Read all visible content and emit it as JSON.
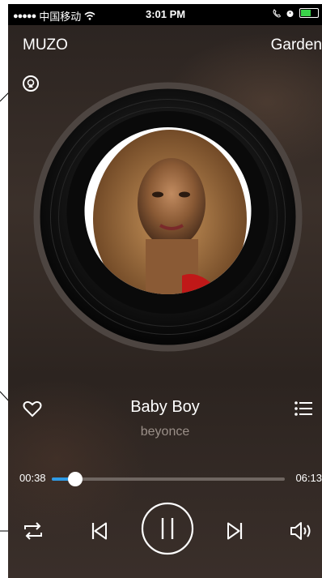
{
  "status_bar": {
    "signal": "●●●●●",
    "carrier": "中国移动",
    "time": "3:01 PM"
  },
  "header": {
    "app_name": "MUZO",
    "room": "Garden"
  },
  "now_playing": {
    "title": "Baby Boy",
    "artist": "beyonce",
    "elapsed": "00:38",
    "total": "06:13",
    "progress_fraction": 0.102
  },
  "icons": {
    "airplay": "airplay-icon",
    "favorite": "heart-icon",
    "playlist": "playlist-icon",
    "repeat": "repeat-icon",
    "previous": "previous-icon",
    "pause": "pause-icon",
    "next": "next-icon",
    "volume": "volume-icon"
  },
  "colors": {
    "accent": "#2f9be6",
    "artist_text": "#9a8f88",
    "battery": "#3ad34a"
  }
}
